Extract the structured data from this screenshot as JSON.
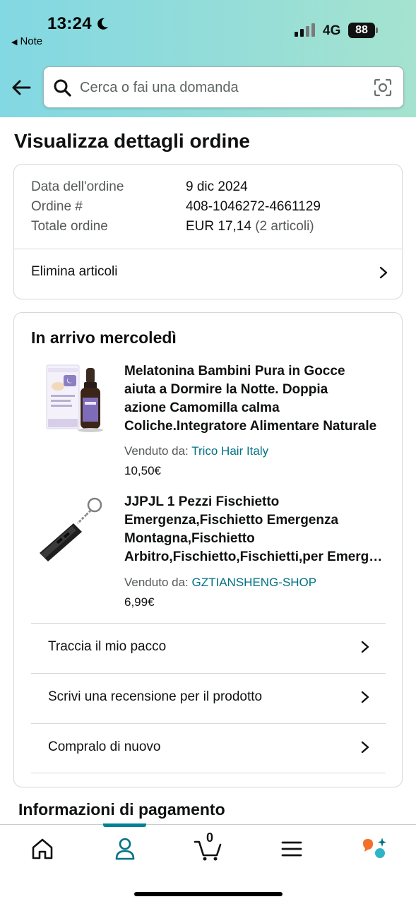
{
  "status_bar": {
    "time": "13:24",
    "back_app": "Note",
    "network": "4G",
    "battery": "88"
  },
  "search": {
    "placeholder": "Cerca o fai una domanda"
  },
  "page_title": "Visualizza dettagli ordine",
  "order_summary": {
    "date_label": "Data dell'ordine",
    "date_value": "9 dic 2024",
    "number_label": "Ordine #",
    "number_value": "408-1046272-4661129",
    "total_label": "Totale ordine",
    "total_value": "EUR 17,14",
    "total_items": "(2 articoli)",
    "delete_items": "Elimina articoli"
  },
  "shipment": {
    "title": "In arrivo mercoledì",
    "products": [
      {
        "title_lines": [
          "Melatonina Bambini Pura in Gocce",
          "aiuta a Dormire la Notte. Doppia",
          "azione Camomilla calma",
          "Coliche.Integratore Alimentare Naturale"
        ],
        "seller_label": "Venduto da:",
        "seller": "Trico Hair Italy",
        "price": "10,50€"
      },
      {
        "title_lines": [
          "JJPJL 1 Pezzi Fischietto",
          "Emergenza,Fischietto Emergenza",
          "Montagna,Fischietto",
          "Arbitro,Fischietto,Fischietti,per Emergenza"
        ],
        "seller_label": "Venduto da:",
        "seller": "GZTIANSHENG-SHOP",
        "price": "6,99€"
      }
    ],
    "actions": [
      "Traccia il mio pacco",
      "Scrivi una recensione per il prodotto",
      "Compralo di nuovo"
    ]
  },
  "payment_title": "Informazioni di pagamento",
  "bottom_nav": {
    "cart_count": "0",
    "items": [
      "home-icon",
      "account-icon",
      "cart-icon",
      "menu-icon",
      "rufus-icon"
    ],
    "active": "account-icon"
  },
  "colors": {
    "link": "#007185",
    "active_nav": "#008296",
    "header_gradient_start": "#82d8e3",
    "header_gradient_end": "#a5e3cf"
  }
}
